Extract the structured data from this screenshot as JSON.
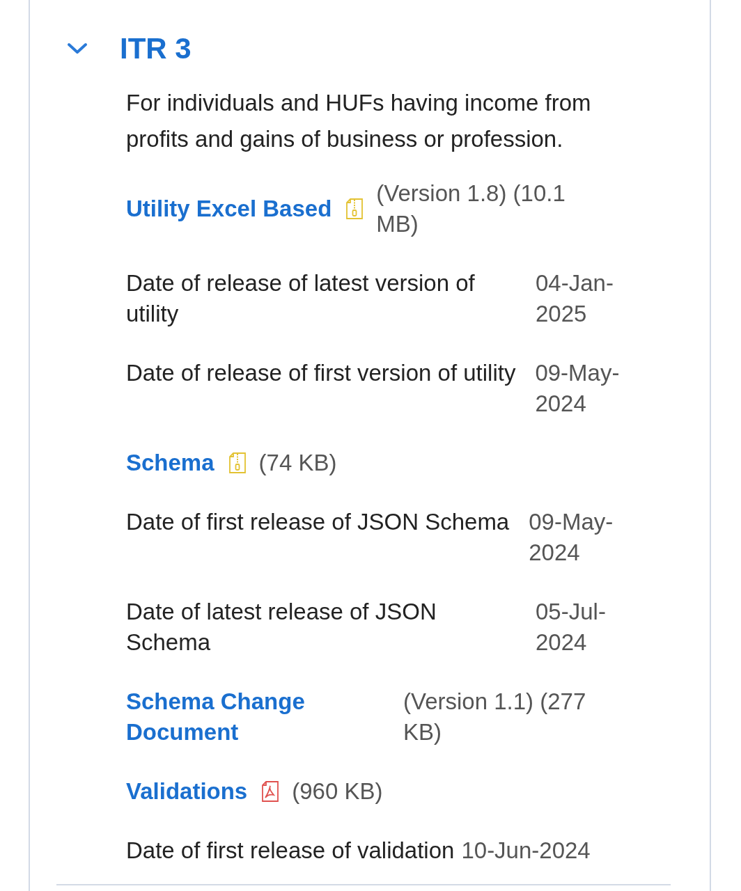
{
  "section": {
    "title": "ITR 3",
    "expanded": true,
    "description": "For individuals and HUFs having income from profits and gains of business or profession.",
    "items": [
      {
        "kind": "zip-link",
        "label": "Utility Excel Based",
        "info": "(Version 1.8) (10.1 MB)"
      },
      {
        "kind": "date",
        "label": "Date of release of latest version of utility",
        "value": "04-Jan-2025"
      },
      {
        "kind": "date",
        "label": "Date of release of first version of utility",
        "value": "09-May-2024"
      },
      {
        "kind": "zip-link",
        "label": "Schema",
        "info": "(74 KB)"
      },
      {
        "kind": "date",
        "label": "Date of first release of JSON Schema",
        "value": "09-May-2024"
      },
      {
        "kind": "date",
        "label": "Date of latest release of JSON Schema",
        "value": "05-Jul-2024"
      },
      {
        "kind": "link",
        "label": "Schema Change Document",
        "info": "(Version 1.1) (277 KB)"
      },
      {
        "kind": "pdf-link",
        "label": "Validations",
        "info": "(960 KB)"
      },
      {
        "kind": "date",
        "label": "Date of first release of validation",
        "value": "10-Jun-2024"
      }
    ]
  }
}
